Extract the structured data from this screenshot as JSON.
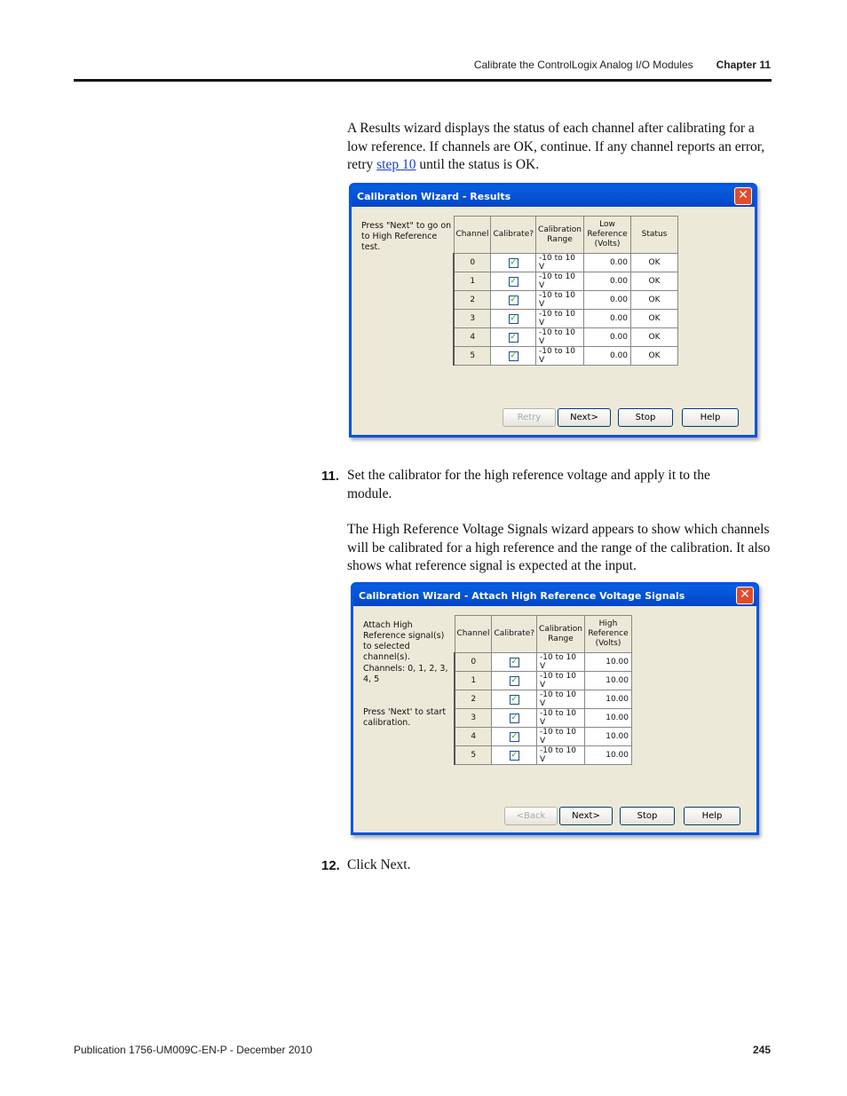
{
  "header": {
    "section": "Calibrate the ControlLogix Analog I/O Modules",
    "chapter": "Chapter 11"
  },
  "intro": {
    "before": "A Results wizard displays the status of each channel after calibrating for a low reference. If channels are OK, continue. If any channel reports an error, retry ",
    "link": "step 10",
    "after": " until the status is OK."
  },
  "dialog1": {
    "title": "Calibration Wizard - Results",
    "close": "✕",
    "info": "Press \"Next\" to go on to High Reference test.",
    "columns": [
      "Channel",
      "Calibrate?",
      "Calibration Range",
      "Low Reference (Volts)",
      "Status"
    ],
    "rows": [
      {
        "channel": "0",
        "range": "-10 to 10 V",
        "ref": "0.00",
        "status": "OK"
      },
      {
        "channel": "1",
        "range": "-10 to 10 V",
        "ref": "0.00",
        "status": "OK"
      },
      {
        "channel": "2",
        "range": "-10 to 10 V",
        "ref": "0.00",
        "status": "OK"
      },
      {
        "channel": "3",
        "range": "-10 to 10 V",
        "ref": "0.00",
        "status": "OK"
      },
      {
        "channel": "4",
        "range": "-10 to 10 V",
        "ref": "0.00",
        "status": "OK"
      },
      {
        "channel": "5",
        "range": "-10 to 10 V",
        "ref": "0.00",
        "status": "OK"
      }
    ],
    "buttons": {
      "retry": "Retry",
      "next": "Next>",
      "stop": "Stop",
      "help": "Help"
    }
  },
  "step11": {
    "number": "11.",
    "text": "Set the calibrator for the high reference voltage and apply it to the module.",
    "follow": "The High Reference Voltage Signals wizard appears to show which channels will be calibrated for a high reference and the range of the calibration. It also shows what reference signal is expected at the input."
  },
  "dialog2": {
    "title": "Calibration Wizard - Attach High Reference Voltage Signals",
    "close": "✕",
    "info1": "Attach High Reference signal(s) to selected channel(s).",
    "info2": "Channels:  0, 1, 2, 3, 4, 5",
    "info3": "Press 'Next' to start calibration.",
    "columns": [
      "Channel",
      "Calibrate?",
      "Calibration Range",
      "High Reference (Volts)"
    ],
    "rows": [
      {
        "channel": "0",
        "range": "-10 to 10 V",
        "ref": "10.00"
      },
      {
        "channel": "1",
        "range": "-10 to 10 V",
        "ref": "10.00"
      },
      {
        "channel": "2",
        "range": "-10 to 10 V",
        "ref": "10.00"
      },
      {
        "channel": "3",
        "range": "-10 to 10 V",
        "ref": "10.00"
      },
      {
        "channel": "4",
        "range": "-10 to 10 V",
        "ref": "10.00"
      },
      {
        "channel": "5",
        "range": "-10 to 10 V",
        "ref": "10.00"
      }
    ],
    "buttons": {
      "back": "<Back",
      "next": "Next>",
      "stop": "Stop",
      "help": "Help"
    }
  },
  "step12": {
    "number": "12.",
    "text": "Click Next."
  },
  "footer": {
    "publication": "Publication 1756-UM009C-EN-P - December 2010",
    "page": "245"
  }
}
